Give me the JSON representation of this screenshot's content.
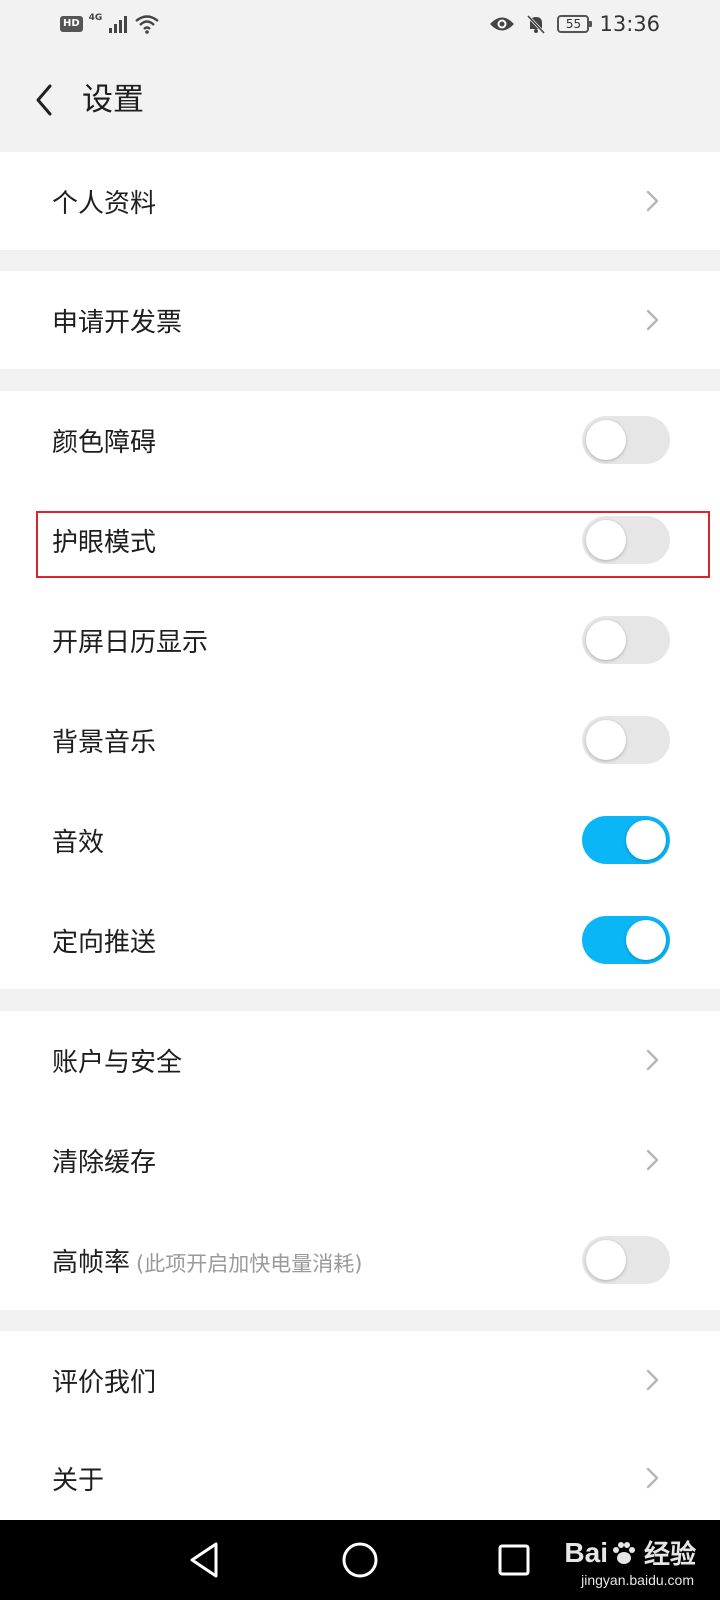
{
  "status_bar": {
    "hd": "HD",
    "network": "4G",
    "battery": "55",
    "time": "13:36"
  },
  "header": {
    "title": "设置"
  },
  "groups": {
    "g1": {
      "profile": "个人资料"
    },
    "g2": {
      "invoice": "申请开发票"
    },
    "g3": {
      "color_blind": {
        "label": "颜色障碍",
        "on": false
      },
      "eye_care": {
        "label": "护眼模式",
        "on": false
      },
      "calendar": {
        "label": "开屏日历显示",
        "on": false
      },
      "bg_music": {
        "label": "背景音乐",
        "on": false
      },
      "sound_effect": {
        "label": "音效",
        "on": true
      },
      "push": {
        "label": "定向推送",
        "on": true
      }
    },
    "g4": {
      "account": "账户与安全",
      "cache": "清除缓存",
      "high_fps": {
        "label": "高帧率",
        "note": "(此项开启加快电量消耗)",
        "on": false
      }
    },
    "g5": {
      "rate": "评价我们",
      "about": "关于"
    }
  },
  "colors": {
    "toggle_on": "#0ab6f5",
    "toggle_off": "#e6e6e6",
    "highlight": "#d9252b"
  },
  "watermark": {
    "brand_left": "Bai",
    "brand_right": "经验",
    "url": "jingyan.baidu.com"
  }
}
